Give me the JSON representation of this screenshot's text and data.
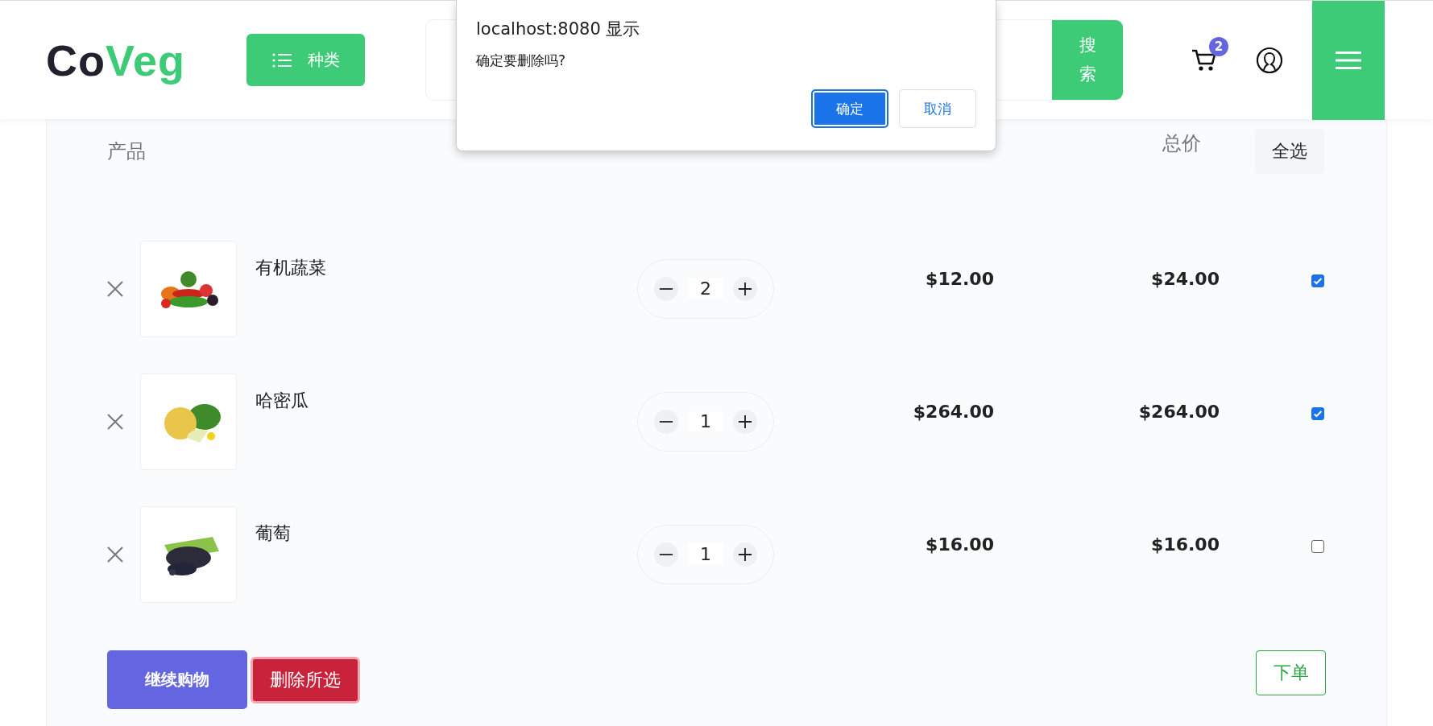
{
  "header": {
    "logo": {
      "part1": "Co",
      "part2": "Veg"
    },
    "category_button": "种类",
    "search_button": "搜索",
    "cart_count": "2"
  },
  "cart": {
    "columns": [
      "产品",
      "总价"
    ],
    "select_all": "全选",
    "rows": [
      {
        "name": "有机蔬菜",
        "quantity": "2",
        "price": "$12.00",
        "total": "$24.00",
        "checked": true
      },
      {
        "name": "哈密瓜",
        "quantity": "1",
        "price": "$264.00",
        "total": "$264.00",
        "checked": true
      },
      {
        "name": "葡萄",
        "quantity": "1",
        "price": "$16.00",
        "total": "$16.00",
        "checked": false
      }
    ],
    "buttons": {
      "continue": "继续购物",
      "delete_selected": "删除所选",
      "order": "下单"
    }
  },
  "dialog": {
    "title": "localhost:8080 显示",
    "message": "确定要删除吗?",
    "buttons": [
      {
        "label": "确定",
        "kind": "primary"
      },
      {
        "label": "取消",
        "kind": "secondary"
      }
    ]
  }
}
